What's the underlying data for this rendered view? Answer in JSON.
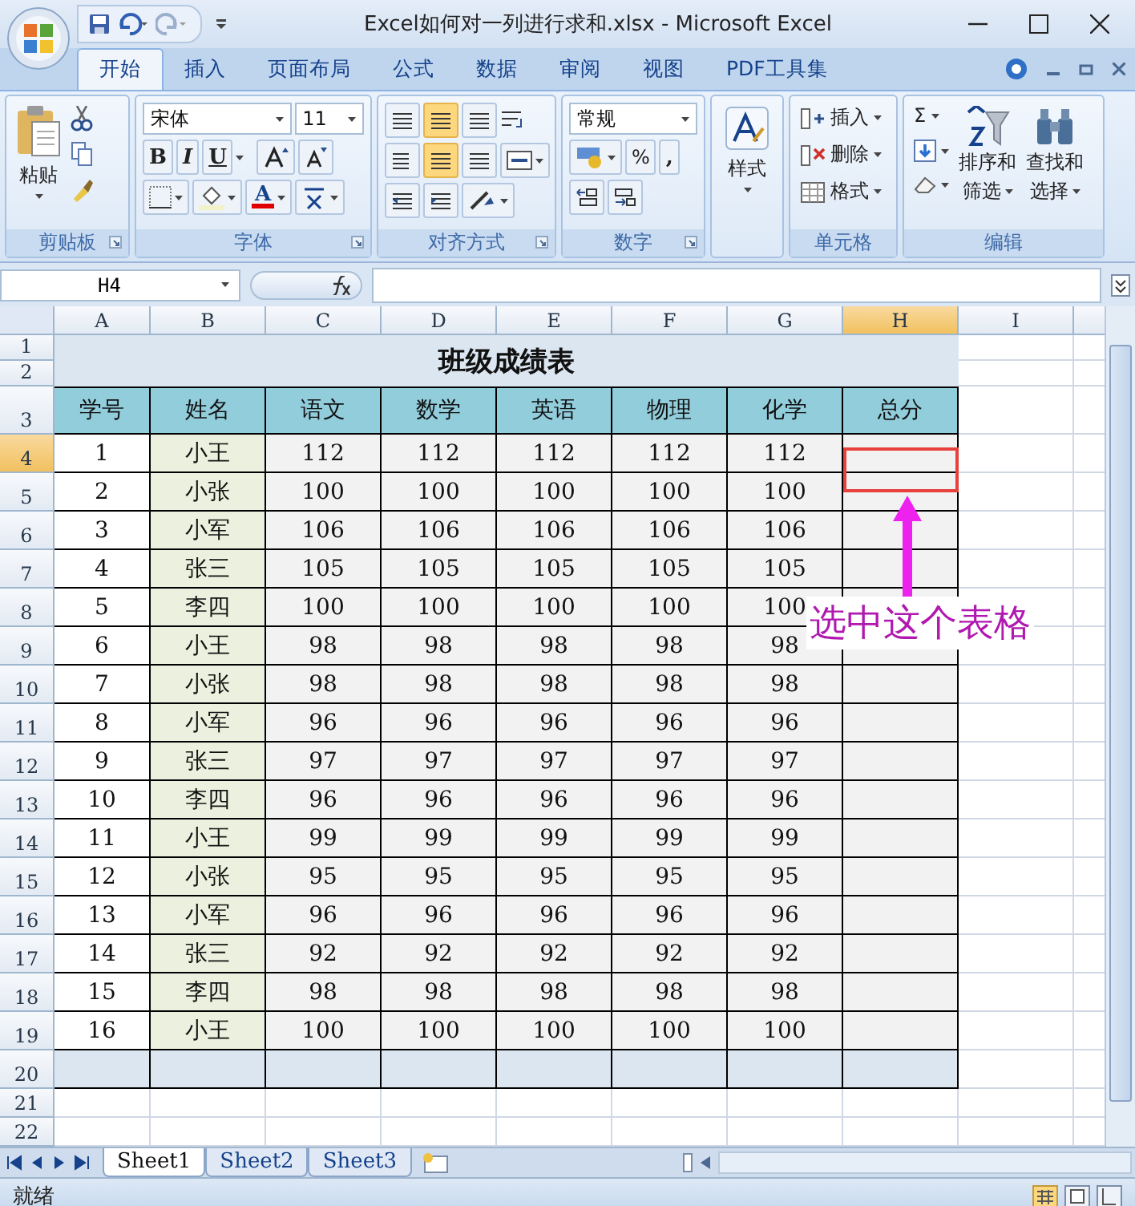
{
  "window": {
    "title": "Excel如何对一列进行求和.xlsx - Microsoft Excel"
  },
  "ribbon_tabs": [
    {
      "label": "开始",
      "selected": true
    },
    {
      "label": "插入",
      "selected": false
    },
    {
      "label": "页面布局",
      "selected": false
    },
    {
      "label": "公式",
      "selected": false
    },
    {
      "label": "数据",
      "selected": false
    },
    {
      "label": "审阅",
      "selected": false
    },
    {
      "label": "视图",
      "selected": false
    },
    {
      "label": "PDF工具集",
      "selected": false
    }
  ],
  "ribbon": {
    "clipboard": {
      "label": "剪贴板",
      "paste": "粘贴"
    },
    "font": {
      "label": "字体",
      "font_name": "宋体",
      "font_size": "11",
      "bold": "B",
      "italic": "I",
      "underline": "U",
      "font_color": "A"
    },
    "alignment": {
      "label": "对齐方式"
    },
    "number": {
      "label": "数字",
      "format": "常规",
      "percent": "%",
      "comma": ","
    },
    "styles": {
      "label": "样式"
    },
    "cells": {
      "label": "单元格",
      "insert": "插入",
      "delete": "删除",
      "format": "格式"
    },
    "editing": {
      "label": "编辑",
      "sum": "Σ",
      "sort": [
        "排序和",
        "筛选"
      ],
      "find": [
        "查找和",
        "选择"
      ]
    }
  },
  "formula_bar": {
    "name_box": "H4"
  },
  "sheet": {
    "columns": [
      {
        "label": "A",
        "selected": false
      },
      {
        "label": "B",
        "selected": false
      },
      {
        "label": "C",
        "selected": false
      },
      {
        "label": "D",
        "selected": false
      },
      {
        "label": "E",
        "selected": false
      },
      {
        "label": "F",
        "selected": false
      },
      {
        "label": "G",
        "selected": false
      },
      {
        "label": "H",
        "selected": true
      },
      {
        "label": "I",
        "selected": false
      }
    ],
    "row_numbers": [
      {
        "label": "1",
        "selected": false
      },
      {
        "label": "2",
        "selected": false
      },
      {
        "label": "3",
        "selected": false
      },
      {
        "label": "4",
        "selected": true
      },
      {
        "label": "5",
        "selected": false
      },
      {
        "label": "6",
        "selected": false
      },
      {
        "label": "7",
        "selected": false
      },
      {
        "label": "8",
        "selected": false
      },
      {
        "label": "9",
        "selected": false
      },
      {
        "label": "10",
        "selected": false
      },
      {
        "label": "11",
        "selected": false
      },
      {
        "label": "12",
        "selected": false
      },
      {
        "label": "13",
        "selected": false
      },
      {
        "label": "14",
        "selected": false
      },
      {
        "label": "15",
        "selected": false
      },
      {
        "label": "16",
        "selected": false
      },
      {
        "label": "17",
        "selected": false
      },
      {
        "label": "18",
        "selected": false
      },
      {
        "label": "19",
        "selected": false
      },
      {
        "label": "20",
        "selected": false
      },
      {
        "label": "21",
        "selected": false
      },
      {
        "label": "22",
        "selected": false
      }
    ],
    "title": "班级成绩表",
    "header": [
      "学号",
      "姓名",
      "语文",
      "数学",
      "英语",
      "物理",
      "化学",
      "总分"
    ],
    "rows": [
      [
        "1",
        "小王",
        "112",
        "112",
        "112",
        "112",
        "112"
      ],
      [
        "2",
        "小张",
        "100",
        "100",
        "100",
        "100",
        "100"
      ],
      [
        "3",
        "小军",
        "106",
        "106",
        "106",
        "106",
        "106"
      ],
      [
        "4",
        "张三",
        "105",
        "105",
        "105",
        "105",
        "105"
      ],
      [
        "5",
        "李四",
        "100",
        "100",
        "100",
        "100",
        "100"
      ],
      [
        "6",
        "小王",
        "98",
        "98",
        "98",
        "98",
        "98"
      ],
      [
        "7",
        "小张",
        "98",
        "98",
        "98",
        "98",
        "98"
      ],
      [
        "8",
        "小军",
        "96",
        "96",
        "96",
        "96",
        "96"
      ],
      [
        "9",
        "张三",
        "97",
        "97",
        "97",
        "97",
        "97"
      ],
      [
        "10",
        "李四",
        "96",
        "96",
        "96",
        "96",
        "96"
      ],
      [
        "11",
        "小王",
        "99",
        "99",
        "99",
        "99",
        "99"
      ],
      [
        "12",
        "小张",
        "95",
        "95",
        "95",
        "95",
        "95"
      ],
      [
        "13",
        "小军",
        "96",
        "96",
        "96",
        "96",
        "96"
      ],
      [
        "14",
        "张三",
        "92",
        "92",
        "92",
        "92",
        "92"
      ],
      [
        "15",
        "李四",
        "98",
        "98",
        "98",
        "98",
        "98"
      ],
      [
        "16",
        "小王",
        "100",
        "100",
        "100",
        "100",
        "100"
      ]
    ],
    "annotation": "选中这个表格"
  },
  "sheet_tabs": [
    {
      "label": "Sheet1",
      "selected": true
    },
    {
      "label": "Sheet2",
      "selected": false
    },
    {
      "label": "Sheet3",
      "selected": false
    }
  ],
  "status": "就绪"
}
